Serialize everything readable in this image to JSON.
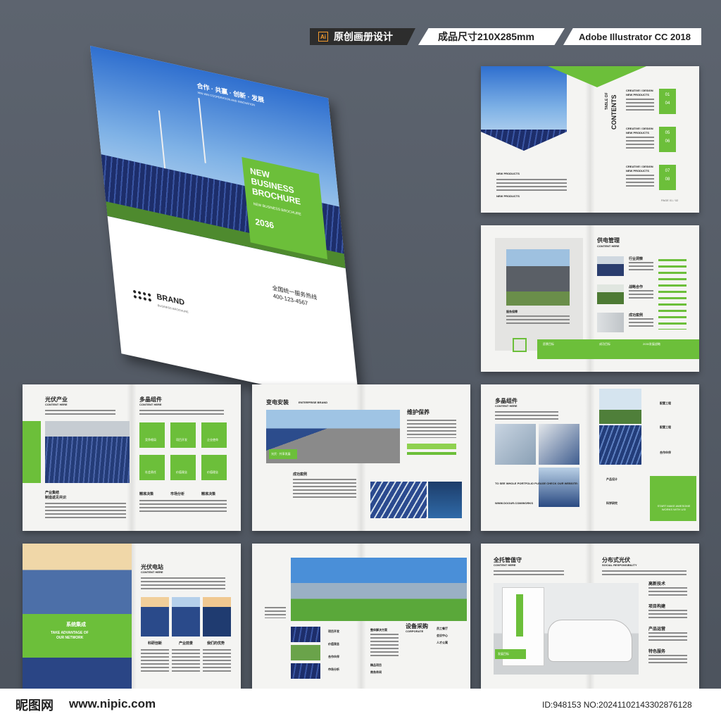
{
  "tags": {
    "ai_icon": "Ai",
    "design": "原创画册设计",
    "size": "成品尺寸210X285mm",
    "software": "Adobe Illustrator CC 2018"
  },
  "cover": {
    "slogan": "合作 · 共赢 · 创新 · 发展",
    "slogan_sub": "WIN WIN COOPERATION AND INNOVATION",
    "title_line1": "NEW",
    "title_line2": "BUSINESS",
    "title_line3": "BROCHURE",
    "subtitle": "NEW BUSINESS BROCHURE",
    "year": "2036",
    "hotline_label": "全国统一服务热线",
    "hotline": "400-123-4567",
    "brand": "BRAND",
    "brand_sub": "BUSINESS BROCHURE"
  },
  "toc": {
    "heading1": "TABLE OF",
    "heading2": "CONTENTS",
    "sections": [
      {
        "title": "CREATIVE / DESIGN",
        "sub": "NEW PRODUCTS",
        "n1": "01",
        "n2": "04"
      },
      {
        "title": "CREATIVE / DESIGN",
        "sub": "NEW PRODUCTS",
        "n1": "05",
        "n2": "06"
      },
      {
        "title": "CREATIVE / DESIGN",
        "sub": "NEW PRODUCTS",
        "n1": "07",
        "n2": "08"
      }
    ],
    "left_label1": "NEW PRODUCTS",
    "left_label2": "NEW PRODUCTS",
    "page_no": "PAGE 01 / 02"
  },
  "spread2": {
    "title": "供电管理",
    "sub": "CONTENT HERE",
    "items": [
      "行业洞察",
      "战略合作",
      "成功案例"
    ],
    "bar_items": [
      "愿景目标",
      "成功目标",
      "2030发展战略"
    ],
    "caption": "服务保障"
  },
  "spread3": {
    "left_title": "光伏产业",
    "left_sub": "CONTENT HERE",
    "left_caption1": "产业集结",
    "left_caption2": "制造返见共识",
    "right_title": "多晶组件",
    "right_sub": "CONTENT HERE",
    "tiles": [
      "竞争格局",
      "项目开发",
      "企业使命",
      "社会责任",
      "价值观念",
      "价值理念"
    ],
    "checks": [
      "精准决策",
      "市场分析",
      "精准决策"
    ]
  },
  "spread4": {
    "title": "变电安装",
    "title_sub": "ENTERPRISE BRAND",
    "right_title": "维护保养",
    "caption": "成功案例",
    "banner": "光伏 · 共享发展"
  },
  "spread5": {
    "title": "多晶组件",
    "sub": "CONTENT HERE",
    "items": [
      "配置工程",
      "配置工程",
      "合作伙伴",
      "产品设计",
      "科学研究"
    ],
    "cta_text": "TO SEE WHOLE PORTFOLIO PLEASE CHECK OUR WEBSITE:",
    "url": "WWW.DOOUR.COM/WORKS",
    "green_cta": "START MAKE AWESOME WORKS WITH US!"
  },
  "spread6": {
    "title": "光伏电站",
    "sub": "CONTENT HERE",
    "banner_title": "系统集成",
    "banner_en1": "TAKE ADVANTAGE OF",
    "banner_en2": "OUR NETWORK",
    "captions": [
      "科研创新",
      "产业前景",
      "我们的优势"
    ]
  },
  "spread7": {
    "title": "设备采购",
    "sub": "CORPORATE",
    "small_title": "整体解决方案",
    "checks": [
      "项目开发",
      "价值观念",
      "合作伙伴",
      "市场分析"
    ],
    "items": [
      "员工餐厅",
      "会议中心",
      "人才公寓",
      "精品项目",
      "商务休闲"
    ]
  },
  "spread8": {
    "left_title": "全托管值守",
    "left_sub": "CONTENT HERE",
    "right_title": "分布式光伏",
    "right_sub": "SOCIAL RESPONSIBILITY",
    "items": [
      "高新技术",
      "项目构建",
      "产品运营",
      "特色服务"
    ],
    "badge": "发展目标"
  },
  "footer": {
    "logo": "昵图网",
    "url": "www.nipic.com",
    "id": "ID:948153 NO:20241102143302876128"
  },
  "colors": {
    "accent": "#6cbf3a",
    "dark": "#2d2d2d"
  }
}
